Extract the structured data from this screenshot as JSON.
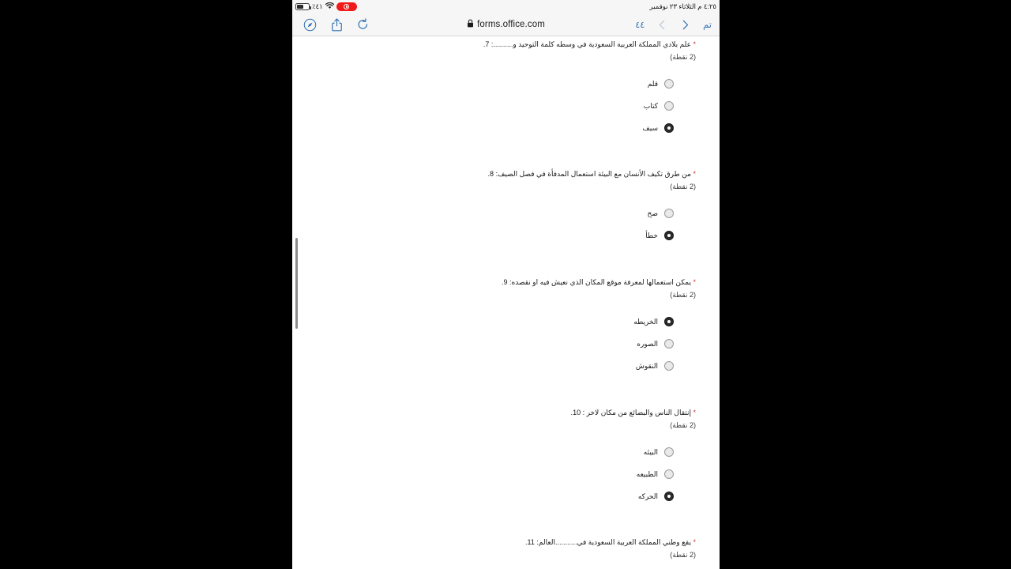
{
  "status_bar": {
    "battery_pct": "٪٤١",
    "wifi_icon": "wifi-icon",
    "recording_badge": "screen-recording-badge",
    "datetime": "٤:٢٥ م   الثلاثاء ٢٣ نوفمبر"
  },
  "toolbar": {
    "compass_icon": "safari-compass-icon",
    "share_icon": "share-icon",
    "reload_icon": "reload-icon",
    "lock_icon": "lock-icon",
    "url": "forms.office.com",
    "tab_count": "٤٤",
    "back_icon": "chevron-back-icon",
    "forward_icon": "chevron-forward-icon",
    "done_label": "تم"
  },
  "form": {
    "required_marker": "*",
    "questions": [
      {
        "number": "7.",
        "text": "علم بلادي المملكة العربية السعودية في وسطه كلمة التوحيد و..........:",
        "points": "(2 نقطة)",
        "options": [
          {
            "label": "قلم",
            "selected": false
          },
          {
            "label": "كتاب",
            "selected": false
          },
          {
            "label": "سيف",
            "selected": true
          }
        ]
      },
      {
        "number": "8.",
        "text": "من طرق تكيف الأنسان مع البيئة استعمال المدفأة في فصل الصيف:",
        "points": "(2 نقطة)",
        "options": [
          {
            "label": "صح",
            "selected": false
          },
          {
            "label": "خطأ",
            "selected": true
          }
        ]
      },
      {
        "number": "9.",
        "text": "يمكن استعمالها لمعرفة موقع المكان الذي نعيش فيه او نقصده:",
        "points": "(2 نقطة)",
        "options": [
          {
            "label": "الخريطه",
            "selected": true
          },
          {
            "label": "الصوره",
            "selected": false
          },
          {
            "label": "النقوش",
            "selected": false
          }
        ]
      },
      {
        "number": "10.",
        "text": "إنتقال الناس والبضائع من مكان لاخر :",
        "points": "(2 نقطة)",
        "options": [
          {
            "label": "البيئه",
            "selected": false
          },
          {
            "label": "الطبيعه",
            "selected": false
          },
          {
            "label": "الحركه",
            "selected": true
          }
        ]
      },
      {
        "number": "11.",
        "text": "يقع وطني المملكة العربية السعودية في...........العالم:",
        "points": "(2 نقطة)",
        "options": []
      }
    ]
  },
  "colors": {
    "accent": "#2f6fb5",
    "required": "#d13438",
    "recording": "#f01a1a",
    "chrome_bg": "#f6f6f6"
  }
}
